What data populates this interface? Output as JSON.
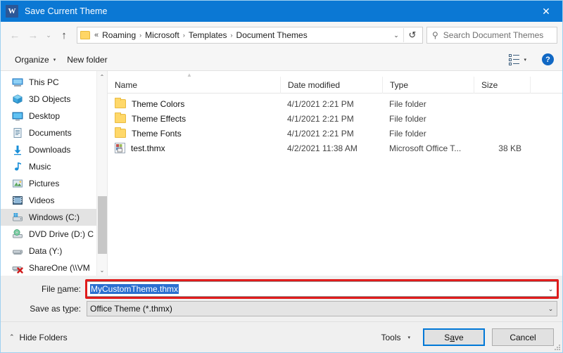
{
  "window": {
    "title": "Save Current Theme",
    "app_icon": "word-icon",
    "close_label": "✕",
    "accent_color": "#0b78d4",
    "annotation_color": "#e01b1b"
  },
  "nav": {
    "back": "←",
    "forward": "→",
    "recent": "⌄",
    "up": "↑",
    "overflow": "«",
    "breadcrumbs": [
      "Roaming",
      "Microsoft",
      "Templates",
      "Document Themes"
    ],
    "separator": "›",
    "dropdown": "⌄",
    "refresh": "↺"
  },
  "search": {
    "icon": "search-icon",
    "placeholder": "Search Document Themes",
    "value": ""
  },
  "toolbar": {
    "organize_label": "Organize",
    "new_folder_label": "New folder",
    "caret": "▾",
    "view_caret": "▾",
    "help_label": "?"
  },
  "sidebar": {
    "items": [
      {
        "label": "This PC",
        "icon": "this-pc-icon",
        "selected": false
      },
      {
        "label": "3D Objects",
        "icon": "3d-objects-icon",
        "selected": false
      },
      {
        "label": "Desktop",
        "icon": "desktop-icon",
        "selected": false
      },
      {
        "label": "Documents",
        "icon": "documents-icon",
        "selected": false
      },
      {
        "label": "Downloads",
        "icon": "downloads-icon",
        "selected": false
      },
      {
        "label": "Music",
        "icon": "music-icon",
        "selected": false
      },
      {
        "label": "Pictures",
        "icon": "pictures-icon",
        "selected": false
      },
      {
        "label": "Videos",
        "icon": "videos-icon",
        "selected": false
      },
      {
        "label": "Windows (C:)",
        "icon": "drive-icon",
        "selected": true
      },
      {
        "label": "DVD Drive (D:) C",
        "icon": "dvd-drive-icon",
        "selected": false
      },
      {
        "label": "Data (Y:)",
        "icon": "network-drive-icon",
        "selected": false
      },
      {
        "label": "ShareOne (\\\\VM",
        "icon": "disconnected-drive-icon",
        "selected": false
      }
    ],
    "scroll_up": "⌃",
    "scroll_down": "⌄"
  },
  "filelist": {
    "sort_indicator": "▲",
    "columns": [
      "Name",
      "Date modified",
      "Type",
      "Size"
    ],
    "rows": [
      {
        "name": "Theme Colors",
        "date": "4/1/2021 2:21 PM",
        "type": "File folder",
        "size": "",
        "icon": "folder-icon"
      },
      {
        "name": "Theme Effects",
        "date": "4/1/2021 2:21 PM",
        "type": "File folder",
        "size": "",
        "icon": "folder-icon"
      },
      {
        "name": "Theme Fonts",
        "date": "4/1/2021 2:21 PM",
        "type": "File folder",
        "size": "",
        "icon": "folder-icon"
      },
      {
        "name": "test.thmx",
        "date": "4/2/2021 11:38 AM",
        "type": "Microsoft Office T...",
        "size": "38 KB",
        "icon": "thmx-file-icon"
      }
    ]
  },
  "form": {
    "filename_label_pre": "File ",
    "filename_label_key": "n",
    "filename_label_post": "ame:",
    "filename_value": "MyCustomTheme.thmx",
    "filetype_label_pre": "Save as t",
    "filetype_label_key": "y",
    "filetype_label_post": "pe:",
    "filetype_value": "Office Theme (*.thmx)",
    "combo_arrow": "⌄"
  },
  "footer": {
    "hide_folders_chevron": "⌃",
    "hide_folders_label": "Hide Folders",
    "tools_label": "Tools",
    "tools_caret": "▾",
    "save_pre": "S",
    "save_key": "a",
    "save_post": "ve",
    "cancel_label": "Cancel"
  }
}
